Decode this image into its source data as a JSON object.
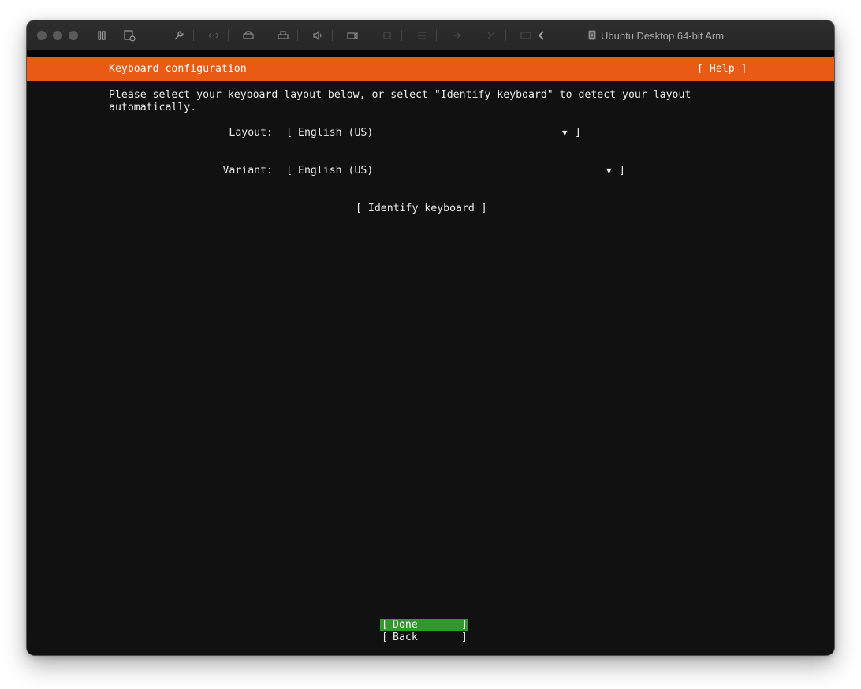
{
  "window": {
    "title": "Ubuntu Desktop 64-bit Arm"
  },
  "toolbar": {
    "icons": [
      "pause-icon",
      "snapshot-icon",
      "settings-wrench-icon",
      "network-icon",
      "disk-icon",
      "printer-icon",
      "sound-icon",
      "camera-icon",
      "usb-icon",
      "shared-folders-icon",
      "bluetooth-icon",
      "display-icon",
      "collapse-chevron-icon"
    ]
  },
  "header": {
    "title": "Keyboard configuration",
    "help": "[ Help ]"
  },
  "intro": {
    "line1": "Please select your keyboard layout below, or select \"Identify keyboard\" to detect your layout",
    "line2": "automatically."
  },
  "layout_field": {
    "label": "Layout:",
    "open_bracket": "[",
    "value": "English (US)",
    "arrow": "▼",
    "close_bracket": "]"
  },
  "variant_field": {
    "label": "Variant:",
    "open_bracket": "[",
    "value": "English (US)",
    "arrow": "▼",
    "close_bracket": "]"
  },
  "identify_button": {
    "label": "[ Identify keyboard ]"
  },
  "footer": {
    "done": {
      "open": "[",
      "label": "Done",
      "close": "]"
    },
    "back": {
      "open": "[",
      "label": "Back",
      "close": "]"
    }
  },
  "colors": {
    "header_bg": "#e95b14",
    "terminal_bg": "#111111",
    "done_bg": "#2e9a2a",
    "text": "#ebebeb"
  }
}
